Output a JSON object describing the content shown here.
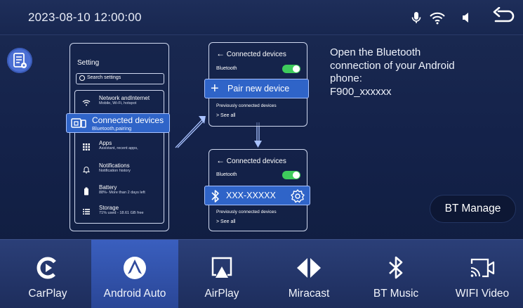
{
  "status_bar": {
    "datetime": "2023-08-10 12:00:00",
    "icons": [
      "microphone-icon",
      "wifi-icon",
      "speaker-icon",
      "back-icon"
    ]
  },
  "setting_panel": {
    "title": "Setting",
    "search_placeholder": "Search settings",
    "rows": [
      {
        "icon": "wifi-icon",
        "title": "Network andInternet",
        "sub": "Mobile, Wi-Fi, hotspot"
      },
      {
        "icon": "apps-grid-icon",
        "title": "Apps",
        "sub": "Assistant, recent apps,"
      },
      {
        "icon": "bell-icon",
        "title": "Notifications",
        "sub": "Notification history"
      },
      {
        "icon": "battery-icon",
        "title": "Battery",
        "sub": "88%- More than 2 days left"
      },
      {
        "icon": "storage-icon",
        "title": "Storage",
        "sub": "71% used - 18.61 GB free"
      }
    ],
    "highlight": {
      "title": "Connected devices",
      "sub": "Bluetooth,pairing"
    }
  },
  "connected_panel_1": {
    "header": "Connected devices",
    "bluetooth_label": "Bluetooth",
    "pair_label": "Pair new device",
    "previous_label": "Previously connected devices",
    "see_all": "See all"
  },
  "connected_panel_2": {
    "header": "Connected devices",
    "bluetooth_label": "Bluetooth",
    "device_name": "XXX-XXXXX",
    "previous_label": "Previously connected devices",
    "see_all": "See all"
  },
  "instruction": {
    "line1": "Open the Bluetooth",
    "line2": "connection of your Android",
    "line3": "phone:",
    "line4": "F900_xxxxxx"
  },
  "bt_manage_label": "BT Manage",
  "dock": [
    {
      "label": "CarPlay",
      "icon": "carplay-icon",
      "active": false
    },
    {
      "label": "Android Auto",
      "icon": "android-auto-icon",
      "active": true
    },
    {
      "label": "AirPlay",
      "icon": "airplay-icon",
      "active": false
    },
    {
      "label": "Miracast",
      "icon": "miracast-icon",
      "active": false
    },
    {
      "label": "BT Music",
      "icon": "bluetooth-icon",
      "active": false
    },
    {
      "label": "WIFI Video",
      "icon": "wifi-video-icon",
      "active": false
    }
  ],
  "colors": {
    "highlight": "#2f64c8",
    "toggle_on": "#3ecb5c",
    "background": "#14224a"
  }
}
